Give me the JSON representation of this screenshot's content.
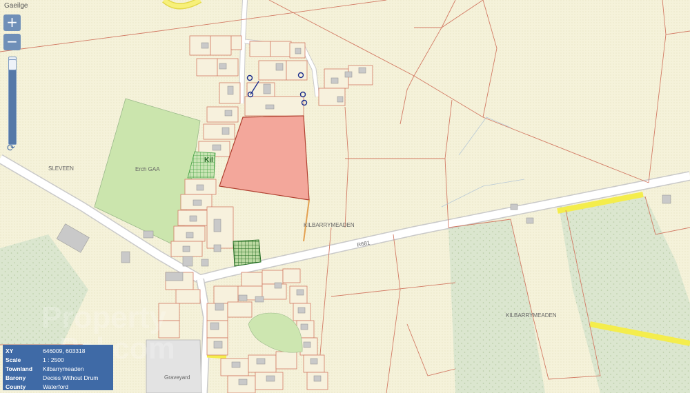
{
  "header": {
    "language_link": "Gaeilge"
  },
  "zoom": {
    "in_label": "+",
    "out_label": "−",
    "level_fraction": 0.97
  },
  "map_labels": {
    "townland_left": "SLEVEEN",
    "gaa": "Erch GAA",
    "kil": "Kil",
    "townland_center": "KILBARRYMEADEN",
    "road": "R681",
    "townland_right": "KILBARRYMEADEN",
    "graveyard": "Graveyard"
  },
  "watermark": {
    "line1": "Property",
    "line2": "Pal.com"
  },
  "info": {
    "rows": [
      {
        "key": "XY",
        "value": "646009, 603318"
      },
      {
        "key": "Scale",
        "value": "1 : 2500"
      },
      {
        "key": "Townland",
        "value": "Kilbarrymeaden"
      },
      {
        "key": "Barony",
        "value": "Decies Without Drum"
      },
      {
        "key": "County",
        "value": "Waterford"
      }
    ]
  },
  "colors": {
    "background": "#f3f1d6",
    "field": "#f6f3dc",
    "boundary": "#cf6a55",
    "highlight_fill": "#f3a79b",
    "green_area": "#cde6b0",
    "forest": "#dde8cf",
    "road_yellow": "#f4ed4c",
    "info_bg": "#3f6aa6"
  }
}
